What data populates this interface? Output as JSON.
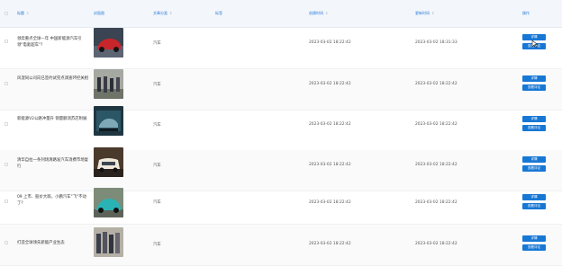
{
  "table": {
    "columns": {
      "title": "标题",
      "cover": "封面图",
      "category": "文章分类",
      "tags": "标签",
      "created": "创建时间",
      "updated": "更新时间",
      "actions": "操作"
    },
    "sort_glyph": "⇕",
    "detail_label": "详情",
    "comments_label": "查看评论",
    "rows": [
      {
        "title": "领奔重点全球—年 中国新能源汽车引领\"电驱超车\"?",
        "category": "汽车",
        "created": "2023-03-02 18:22:42",
        "updated": "2023-03-02 18:31:33"
      },
      {
        "title": "风湿同公司向已签约试完点调查环控关相",
        "category": "汽车",
        "created": "2023-03-02 18:22:42",
        "updated": "2023-03-02 18:22:42"
      },
      {
        "title": "新能源V2公路冲量升 销量额消苏店附展",
        "category": "汽车",
        "created": "2023-03-02 18:22:42",
        "updated": "2023-03-02 18:22:42"
      },
      {
        "title": "清华自拉一条列场清路发汽车消费市场复行",
        "category": "汽车",
        "created": "2023-03-02 18:22:42",
        "updated": "2023-03-02 18:22:42"
      },
      {
        "title": "09 上市、股价大跌，小鹏汽车\"飞\"不动了?",
        "category": "汽车",
        "created": "2023-03-02 18:22:42",
        "updated": "2023-03-02 18:22:42"
      },
      {
        "title": "打造全球领先新能产业生态",
        "category": "汽车",
        "created": "2023-03-02 18:22:42",
        "updated": "2023-03-02 18:22:42"
      }
    ]
  },
  "colors": {
    "accent": "#1777d5",
    "header_text": "#2a77d4",
    "header_bg": "#f3f7fc"
  },
  "icons": {
    "row_checkbox": "checkbox-icon",
    "cursor": "mouse-pointer-icon"
  }
}
